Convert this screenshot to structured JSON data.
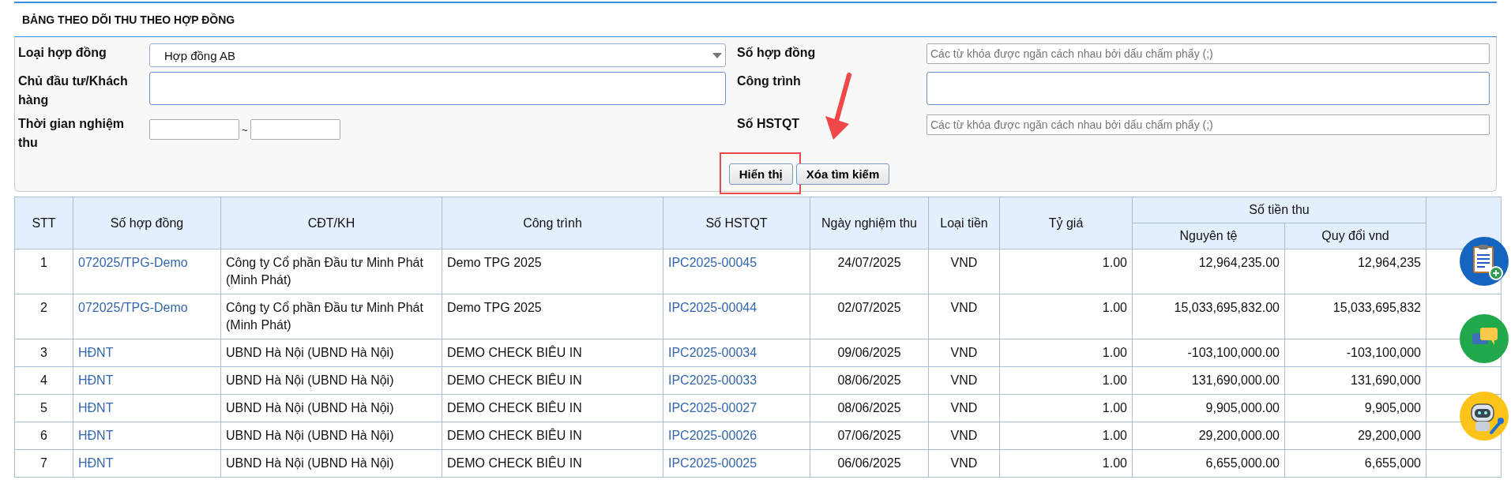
{
  "title": "BẢNG THEO DÕI THU THEO HỢP ĐỒNG",
  "filter_rows": [
    {
      "left": {
        "label": "Loại hợp đồng",
        "kind": "select",
        "value": "Hợp đồng AB"
      },
      "right": {
        "label": "Số hợp đồng",
        "kind": "text",
        "placeholder": "Các từ khóa được ngăn cách nhau bởi dấu chấm phẩy (;)"
      }
    },
    {
      "left": {
        "label": "Chủ đầu tư/Khách hàng",
        "kind": "tall"
      },
      "right": {
        "label": "Công trình",
        "kind": "tall"
      }
    },
    {
      "left": {
        "label": "Thời gian nghiệm thu",
        "kind": "range",
        "separator": "~"
      },
      "right": {
        "label": "Số HSTQT",
        "kind": "text",
        "placeholder": "Các từ khóa được ngăn cách nhau bởi dấu chấm phẩy (;)"
      }
    }
  ],
  "buttons": [
    {
      "label": "Hiển thị",
      "highlighted": true
    },
    {
      "label": "Xóa tìm kiếm",
      "highlighted": false
    }
  ],
  "table": {
    "columns": [
      {
        "label": "STT",
        "kind": "center"
      },
      {
        "label": "Số hợp đồng",
        "kind": "link"
      },
      {
        "label": "CĐT/KH",
        "kind": "text"
      },
      {
        "label": "Công trình",
        "kind": "text"
      },
      {
        "label": "Số HSTQT",
        "kind": "link"
      },
      {
        "label": "Ngày nghiệm thu",
        "kind": "center"
      },
      {
        "label": "Loại tiền",
        "kind": "center"
      },
      {
        "label": "Tỷ giá",
        "kind": "number"
      },
      {
        "label": "Số tiền thu",
        "colspan": 2,
        "children": [
          {
            "label": "Nguyên tệ",
            "kind": "number"
          },
          {
            "label": "Quy đổi vnd",
            "kind": "number"
          }
        ]
      }
    ],
    "rows": [
      [
        "1",
        "072025/TPG-Demo",
        "Công ty Cổ phần Đầu tư Minh Phát (Minh Phát)",
        "Demo TPG 2025",
        "IPC2025-00045",
        "24/07/2025",
        "VND",
        "1.00",
        "12,964,235.00",
        "12,964,235"
      ],
      [
        "2",
        "072025/TPG-Demo",
        "Công ty Cổ phần Đầu tư Minh Phát (Minh Phát)",
        "Demo TPG 2025",
        "IPC2025-00044",
        "02/07/2025",
        "VND",
        "1.00",
        "15,033,695,832.00",
        "15,033,695,832"
      ],
      [
        "3",
        "HĐNT",
        "UBND Hà Nội (UBND Hà Nội)",
        "DEMO CHECK BIÊU IN",
        "IPC2025-00034",
        "09/06/2025",
        "VND",
        "1.00",
        "-103,100,000.00",
        "-103,100,000"
      ],
      [
        "4",
        "HĐNT",
        "UBND Hà Nội (UBND Hà Nội)",
        "DEMO CHECK BIÊU IN",
        "IPC2025-00033",
        "08/06/2025",
        "VND",
        "1.00",
        "131,690,000.00",
        "131,690,000"
      ],
      [
        "5",
        "HĐNT",
        "UBND Hà Nội (UBND Hà Nội)",
        "DEMO CHECK BIÊU IN",
        "IPC2025-00027",
        "08/06/2025",
        "VND",
        "1.00",
        "9,905,000.00",
        "9,905,000"
      ],
      [
        "6",
        "HĐNT",
        "UBND Hà Nội (UBND Hà Nội)",
        "DEMO CHECK BIÊU IN",
        "IPC2025-00026",
        "07/06/2025",
        "VND",
        "1.00",
        "29,200,000.00",
        "29,200,000"
      ],
      [
        "7",
        "HĐNT",
        "UBND Hà Nội (UBND Hà Nội)",
        "DEMO CHECK BIÊU IN",
        "IPC2025-00025",
        "06/06/2025",
        "VND",
        "1.00",
        "6,655,000.00",
        "6,655,000"
      ]
    ]
  }
}
